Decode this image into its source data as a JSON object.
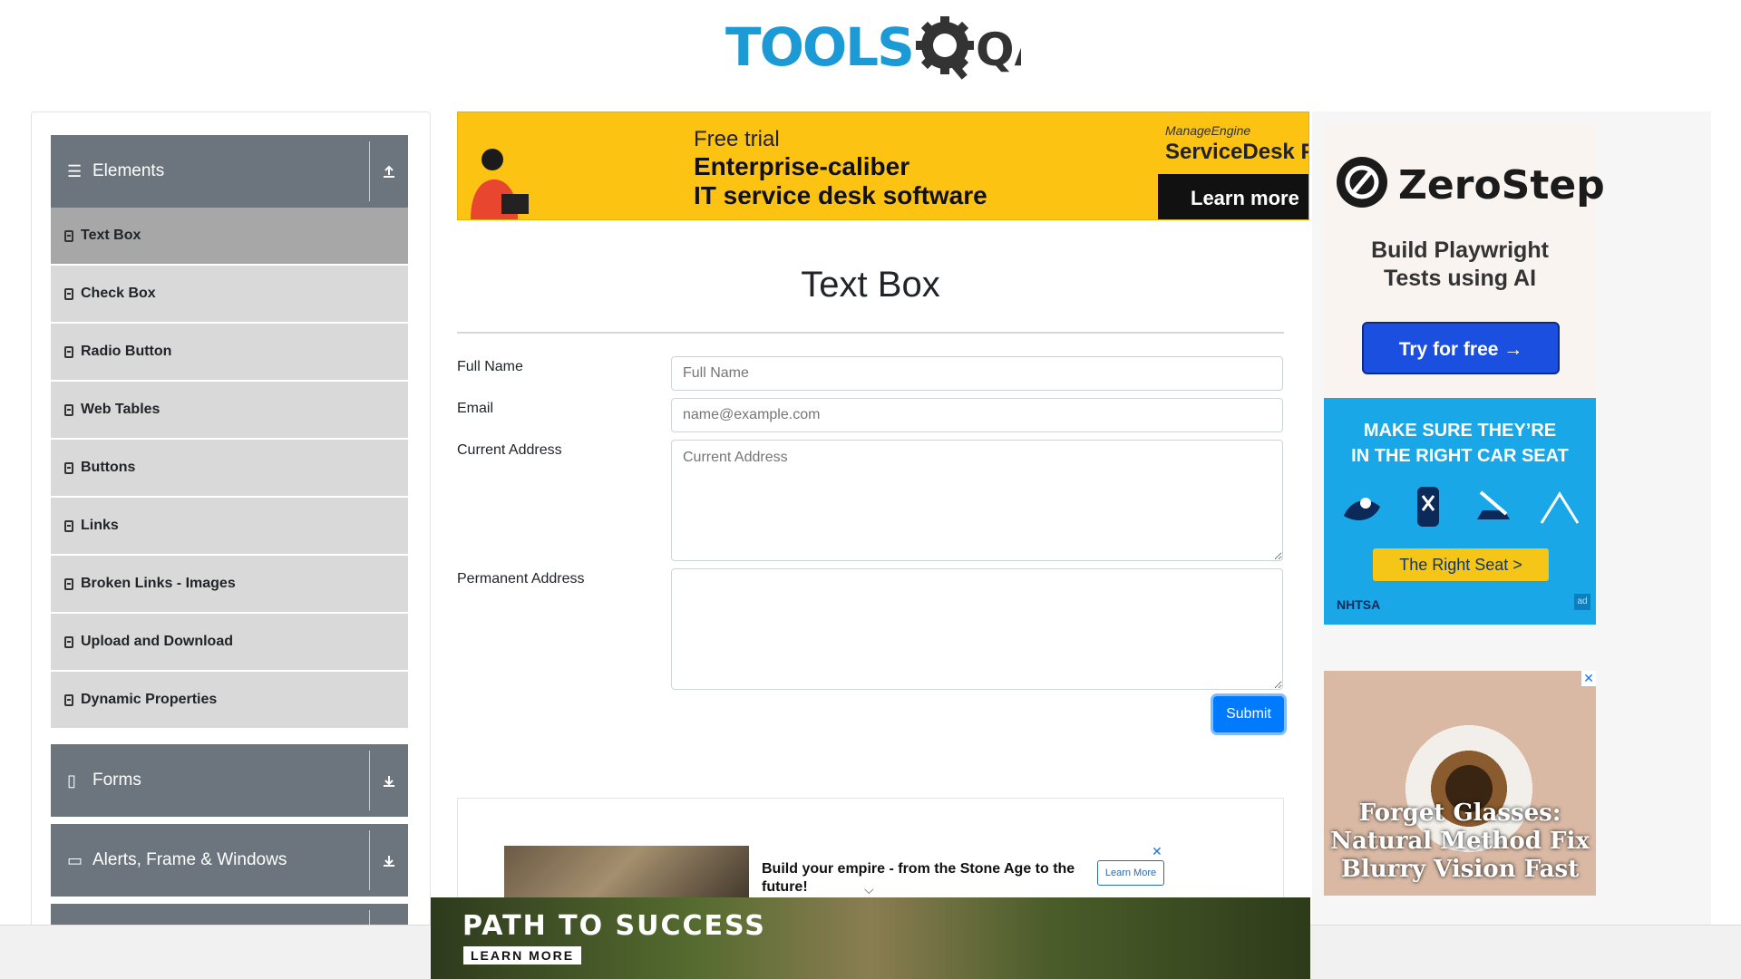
{
  "header": {
    "logo_text": "TOOLS",
    "logo_text_suffix": "QA"
  },
  "sidebar": {
    "groups": [
      {
        "label": "Elements",
        "toggle": "up-arrow"
      },
      {
        "label": "Forms",
        "toggle": "down-arrow"
      },
      {
        "label": "Alerts, Frame & Windows",
        "toggle": "down-arrow"
      }
    ],
    "items": [
      {
        "label": "Text Box",
        "active": true
      },
      {
        "label": "Check Box"
      },
      {
        "label": "Radio Button"
      },
      {
        "label": "Web Tables"
      },
      {
        "label": "Buttons"
      },
      {
        "label": "Links"
      },
      {
        "label": "Broken Links - Images"
      },
      {
        "label": "Upload and Download"
      },
      {
        "label": "Dynamic Properties"
      }
    ]
  },
  "top_banner": {
    "free": "Free trial",
    "line1": "Enterprise-caliber",
    "line2": "IT service desk software",
    "brand_small": "ManageEngine",
    "brand": "ServiceDesk Plu",
    "cta": "Learn more"
  },
  "main": {
    "title": "Text Box",
    "fields": {
      "full_name_label": "Full Name",
      "full_name_placeholder": "Full Name",
      "email_label": "Email",
      "email_placeholder": "name@example.com",
      "current_address_label": "Current Address",
      "current_address_placeholder": "Current Address",
      "permanent_address_label": "Permanent Address"
    },
    "submit_label": "Submit"
  },
  "inline_ad": {
    "text": "Build your empire - from the Stone Age to the future!",
    "cta": "Learn More",
    "close": "✕",
    "chevron": "⌵"
  },
  "right_ads": {
    "zerostep": {
      "name": "ZeroStep",
      "sub1": "Build Playwright",
      "sub2": "Tests using AI",
      "cta": "Try for free →"
    },
    "nhtsa": {
      "head1": "MAKE SURE THEY’RE",
      "head2": "IN THE RIGHT CAR SEAT",
      "cta": "The Right Seat >",
      "logo": "NHTSA",
      "ad_badge": "ad"
    },
    "eye": {
      "close": "✕",
      "line1": "Forget Glasses:",
      "line2": "Natural Method Fix",
      "line3": "Blurry Vision Fast"
    }
  },
  "bottom_ad": {
    "title": "PATH TO SUCCESS",
    "cta": "LEARN MORE"
  },
  "colors": {
    "brand_blue": "#1c9ad6",
    "sidebar_header": "#6c757d",
    "submit": "#007bff",
    "active_item": "#a7a7a7"
  }
}
